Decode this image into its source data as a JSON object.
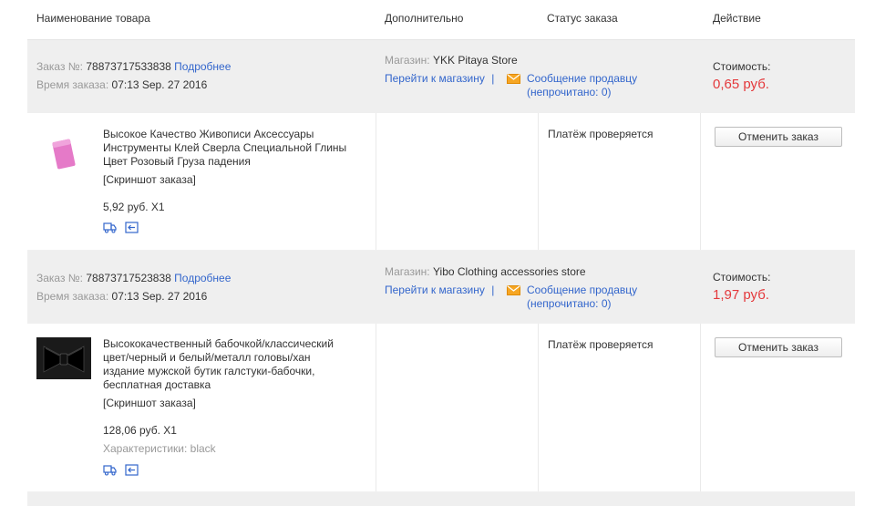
{
  "header": {
    "col_product": "Наименование товара",
    "col_extra": "Дополнительно",
    "col_status": "Статус заказа",
    "col_action": "Действие"
  },
  "labels": {
    "order_no": "Заказ №:",
    "details": "Подробнее",
    "order_time": "Время заказа:",
    "shop": "Магазин:",
    "go_to_shop": "Перейти к магазину",
    "separator": "|",
    "message_seller": "Сообщение продавцу",
    "unread_prefix": "(непрочитано:",
    "unread_suffix": ")",
    "cost": "Стоимость:",
    "screenshot": "[Скриншот заказа]",
    "cancel_order": "Отменить заказ",
    "characteristics": "Характеристики:"
  },
  "orders": [
    {
      "number": "78873717533838",
      "time": "07:13 Sep. 27 2016",
      "shop": "YKK Pitaya Store",
      "unread": "0",
      "cost": "0,65 руб.",
      "product_title_lines": [
        "Высокое Качество Живописи Аксессуары",
        "Инструменты Клей Сверла Специальной Глины",
        "Цвет Розовый Груза падения"
      ],
      "price_qty": "5,92 руб. X1",
      "status": "Платёж проверяется",
      "characteristics": ""
    },
    {
      "number": "78873717523838",
      "time": "07:13 Sep. 27 2016",
      "shop": "Yibo Clothing accessories store",
      "unread": "0",
      "cost": "1,97 руб.",
      "product_title_lines": [
        "Высококачественный бабочкой/классический",
        "цвет/черный и белый/металл головы/хан",
        "издание мужской бутик галстуки-бабочки,",
        "бесплатная доставка"
      ],
      "price_qty": "128,06 руб. X1",
      "status": "Платёж проверяется",
      "characteristics": "black"
    }
  ],
  "colors": {
    "link": "#3366cc",
    "price": "#e4393c",
    "head_bg": "#efefef"
  },
  "icons": {
    "mail": "envelope-icon",
    "shipping": "truck-icon",
    "refund": "return-icon"
  }
}
